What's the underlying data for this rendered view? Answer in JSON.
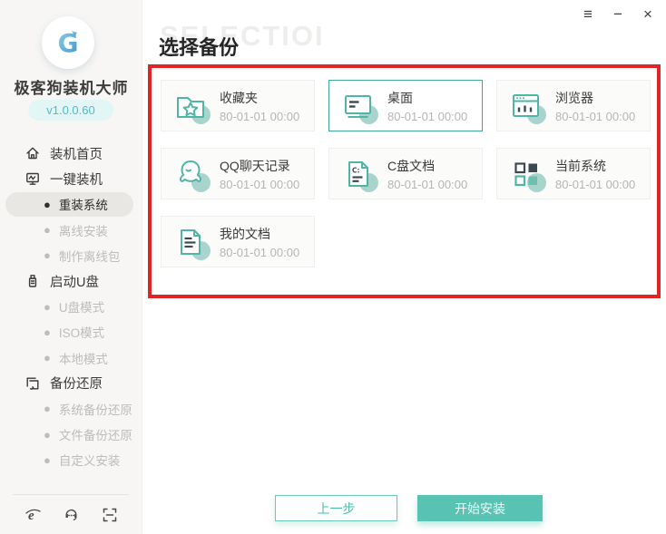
{
  "window": {
    "controls": {
      "menu": "≡",
      "minimize": "−",
      "close": "×"
    }
  },
  "sidebar": {
    "app_name": "极客狗装机大师",
    "version": "v1.0.0.60",
    "menu": [
      {
        "label": "装机首页",
        "type": "parent",
        "icon": "home-icon",
        "active": false
      },
      {
        "label": "一键装机",
        "type": "parent",
        "icon": "monitor-icon",
        "active": false
      },
      {
        "label": "重装系统",
        "type": "sub",
        "active": true
      },
      {
        "label": "离线安装",
        "type": "sub",
        "active": false
      },
      {
        "label": "制作离线包",
        "type": "sub",
        "active": false
      },
      {
        "label": "启动U盘",
        "type": "parent",
        "icon": "usb-icon",
        "active": false
      },
      {
        "label": "U盘模式",
        "type": "sub",
        "active": false
      },
      {
        "label": "ISO模式",
        "type": "sub",
        "active": false
      },
      {
        "label": "本地模式",
        "type": "sub",
        "active": false
      },
      {
        "label": "备份还原",
        "type": "parent",
        "icon": "restore-icon",
        "active": false
      },
      {
        "label": "系统备份还原",
        "type": "sub",
        "active": false
      },
      {
        "label": "文件备份还原",
        "type": "sub",
        "active": false
      },
      {
        "label": "自定义安装",
        "type": "sub",
        "active": false
      }
    ],
    "footer_icons": [
      "ie-browser-icon",
      "support-headset-icon",
      "scan-icon"
    ]
  },
  "main": {
    "watermark": "SELECTIOI",
    "title": "选择备份",
    "backups": [
      {
        "name": "收藏夹",
        "date": "80-01-01 00:00",
        "icon": "favorites-folder-icon",
        "selected": false
      },
      {
        "name": "桌面",
        "date": "80-01-01 00:00",
        "icon": "desktop-icon",
        "selected": true
      },
      {
        "name": "浏览器",
        "date": "80-01-01 00:00",
        "icon": "browser-icon",
        "selected": false
      },
      {
        "name": "QQ聊天记录",
        "date": "80-01-01 00:00",
        "icon": "qq-icon",
        "selected": false
      },
      {
        "name": "C盘文档",
        "date": "80-01-01 00:00",
        "icon": "c-drive-doc-icon",
        "selected": false
      },
      {
        "name": "当前系统",
        "date": "80-01-01 00:00",
        "icon": "system-grid-icon",
        "selected": false
      },
      {
        "name": "我的文档",
        "date": "80-01-01 00:00",
        "icon": "my-documents-icon",
        "selected": false
      }
    ],
    "buttons": {
      "prev": "上一步",
      "start": "开始安装"
    }
  },
  "colors": {
    "accent_teal": "#58c3b3",
    "icon_stroke_teal": "#4fb5a5",
    "icon_dark": "#3e4852",
    "annotation_red": "#df2525",
    "version_text": "#53b9c8"
  }
}
